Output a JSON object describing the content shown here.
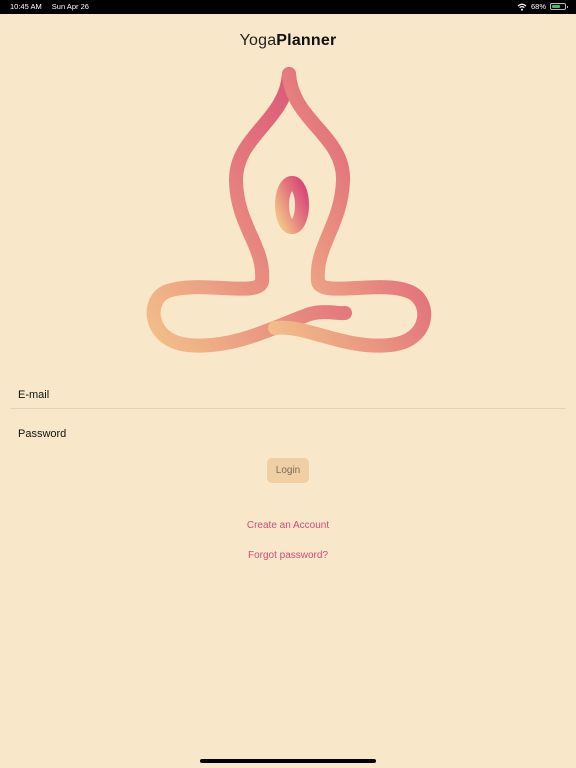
{
  "status_bar": {
    "time": "10:45 AM",
    "date": "Sun Apr 26",
    "battery_percent": "68%",
    "battery_level": 0.68,
    "icons": [
      "wifi-icon",
      "battery-icon"
    ]
  },
  "header": {
    "title_light": "Yoga",
    "title_bold": "Planner"
  },
  "logo": {
    "icon": "lotus-meditation-icon",
    "colors": [
      "#f2c089",
      "#e47a7d",
      "#d94878"
    ]
  },
  "form": {
    "email_label": "E-mail",
    "password_label": "Password",
    "login_label": "Login"
  },
  "links": {
    "create_account": "Create an Account",
    "forgot_password": "Forgot password?"
  },
  "colors": {
    "background": "#f8e7c8",
    "accent": "#d54b7a",
    "button": "#f0cfa4"
  }
}
